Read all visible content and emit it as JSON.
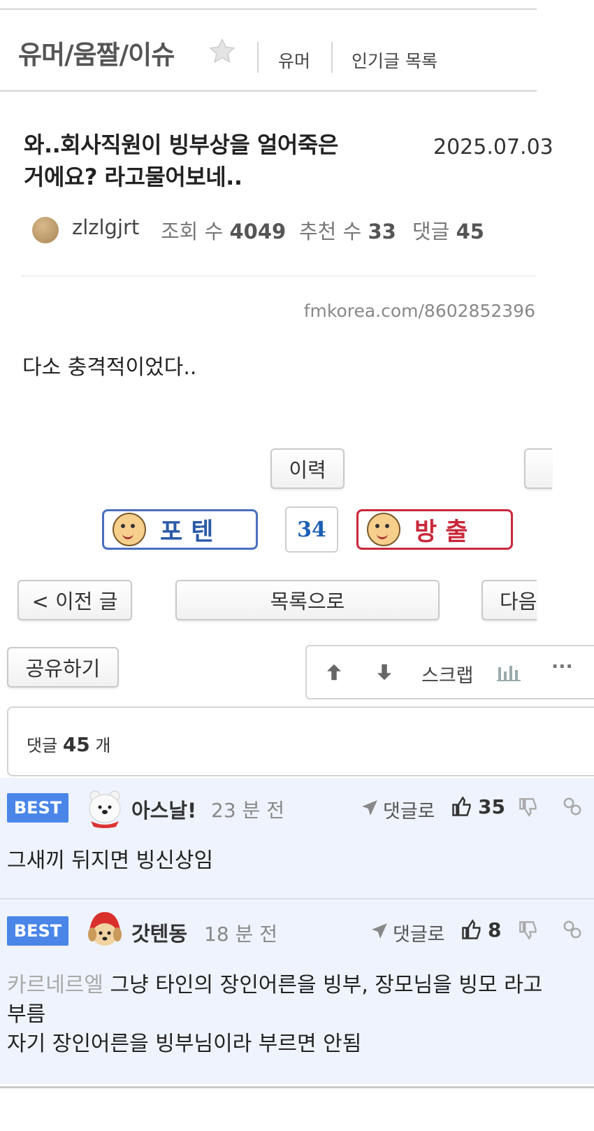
{
  "header": {
    "board_title": "유머/움짤/이슈",
    "links": [
      "유머",
      "인기글 목록"
    ]
  },
  "article": {
    "title_line1": "와..회사직원이 빙부상을 얼어죽은",
    "title_line2": "거에요? 라고물어보네..",
    "date": "2025.07.03",
    "author": "zlzlgjrt",
    "views_label": "조회 수",
    "views": "4049",
    "recommend_label": "추천 수",
    "recommend": "33",
    "comments_label": "댓글",
    "comments": "45",
    "source_url": "fmkorea.com/8602852396",
    "body": "다소 충격적이었다.."
  },
  "actions": {
    "history_button": "이력",
    "vote_up_label": "포텐",
    "vote_count": "34",
    "vote_down_label": "방출",
    "prev_button": "< 이전 글",
    "list_button": "목록으로",
    "next_button": "다음",
    "share_button": "공유하기",
    "scrap_label": "스크랩"
  },
  "comments_section": {
    "label": "댓글",
    "count": "45",
    "suffix": "개"
  },
  "comments": [
    {
      "badge": "BEST",
      "author": "아스날!",
      "time": "23 분 전",
      "reply_label": "댓글로",
      "likes": "35",
      "mention": "",
      "text_line1": "그새끼 뒤지면 빙신상임",
      "text_line2": "",
      "text_line3": ""
    },
    {
      "badge": "BEST",
      "author": "갓텐동",
      "time": "18 분 전",
      "reply_label": "댓글로",
      "likes": "8",
      "mention": "카르네르엘",
      "text_line1": " 그냥 타인의 장인어른을 빙부, 장모님을 빙모 라고",
      "text_line2": "부름",
      "text_line3": "자기 장인어른을 빙부님이라 부르면 안됨"
    }
  ],
  "colors": {
    "best_badge": "#4a86e8",
    "comment_bg": "#eef3fd",
    "vote_up": "#4a6fbf",
    "vote_down": "#c8283a"
  }
}
